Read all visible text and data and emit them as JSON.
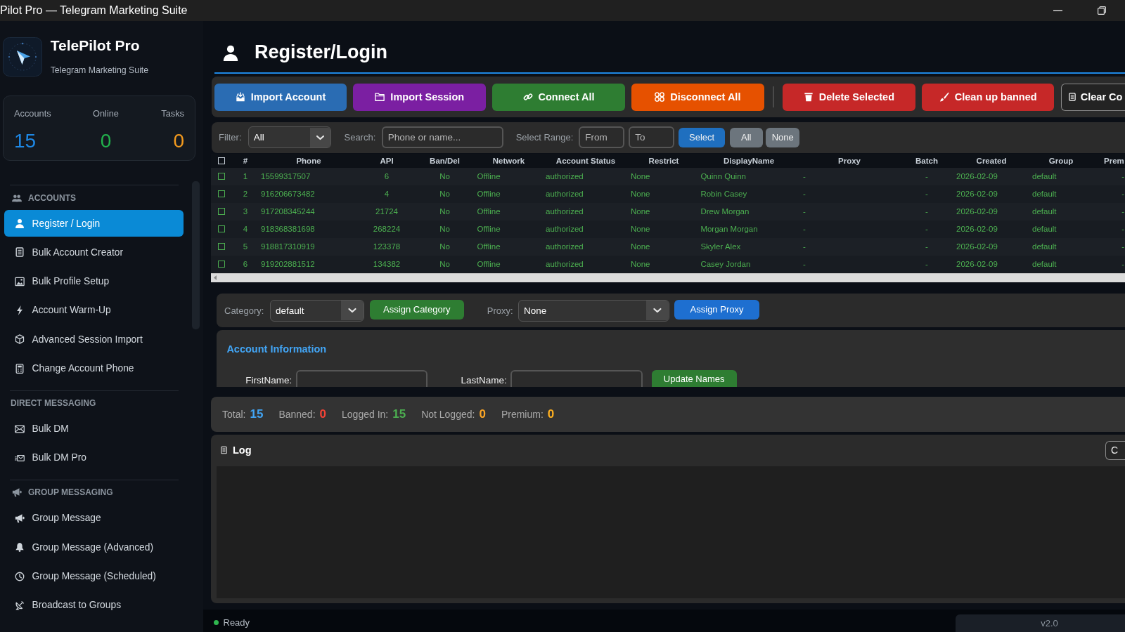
{
  "window": {
    "title": "Pilot Pro — Telegram Marketing Suite"
  },
  "sidebar": {
    "app_name": "TelePilot Pro",
    "tagline": "Telegram Marketing Suite",
    "stats": [
      {
        "label": "Accounts",
        "value": "15",
        "color": "#1e88e5"
      },
      {
        "label": "Online",
        "value": "0",
        "color": "#22b24c"
      },
      {
        "label": "Tasks",
        "value": "0",
        "color": "#f39a1e"
      }
    ],
    "sections": [
      {
        "title": "ACCOUNTS",
        "items": [
          {
            "label": "Register / Login",
            "selected": true
          },
          {
            "label": "Bulk Account Creator",
            "selected": false
          },
          {
            "label": "Bulk Profile Setup",
            "selected": false
          },
          {
            "label": "Account Warm-Up",
            "selected": false
          },
          {
            "label": "Advanced Session Import",
            "selected": false
          },
          {
            "label": "Change Account Phone",
            "selected": false
          }
        ]
      },
      {
        "title": "DIRECT MESSAGING",
        "items": [
          {
            "label": "Bulk DM",
            "selected": false
          },
          {
            "label": "Bulk DM Pro",
            "selected": false
          }
        ]
      },
      {
        "title": "GROUP MESSAGING",
        "items": [
          {
            "label": "Group Message",
            "selected": false
          },
          {
            "label": "Group Message (Advanced)",
            "selected": false
          },
          {
            "label": "Group Message (Scheduled)",
            "selected": false
          },
          {
            "label": "Broadcast to Groups",
            "selected": false
          }
        ]
      }
    ]
  },
  "page": {
    "title": "Register/Login"
  },
  "toolbar": {
    "groups": [
      {
        "buttons": [
          {
            "label": "Import Account",
            "kind": "filled",
            "color": "#2a6cb3"
          },
          {
            "label": "Import Session",
            "kind": "filled",
            "color": "#7b1fa2"
          },
          {
            "label": "Connect All",
            "kind": "filled",
            "color": "#2e7d32"
          },
          {
            "label": "Disconnect All",
            "kind": "filled",
            "color": "#e65100"
          }
        ]
      },
      {
        "buttons": [
          {
            "label": "Delete Selected",
            "kind": "filled",
            "color": "#c62828"
          },
          {
            "label": "Clean up banned",
            "kind": "filled",
            "color": "#c62828"
          },
          {
            "label": "Clear Co",
            "kind": "outline",
            "color": "#8a8a8a"
          }
        ]
      }
    ]
  },
  "filter_bar": {
    "filter": {
      "label": "Filter:",
      "value": "All"
    },
    "search": {
      "label": "Search:",
      "placeholder": "Phone or name..."
    },
    "range": {
      "label": "Select Range:",
      "from": {
        "placeholder": "From"
      },
      "to": {
        "placeholder": "To"
      }
    },
    "buttons": [
      {
        "label": "Select",
        "color": "#1f6fbf"
      },
      {
        "label": "All",
        "color": "#6c757d"
      },
      {
        "label": "None",
        "color": "#6c757d"
      }
    ]
  },
  "table": {
    "select_all": {
      "checked": false
    },
    "columns": [
      "#",
      "Phone",
      "API",
      "Ban/Del",
      "Network",
      "Account Status",
      "Restrict",
      "DisplayName",
      "Proxy",
      "Batch",
      "Created",
      "Group",
      "Prem"
    ],
    "rows": [
      {
        "checked": false,
        "cells": [
          "1",
          "15599317507",
          "6",
          "No",
          "Offline",
          "authorized",
          "None",
          "Quinn Quinn",
          "-",
          "-",
          "2026-02-09",
          "default",
          "-"
        ]
      },
      {
        "checked": false,
        "cells": [
          "2",
          "916206673482",
          "4",
          "No",
          "Offline",
          "authorized",
          "None",
          "Robin Casey",
          "-",
          "-",
          "2026-02-09",
          "default",
          "-"
        ]
      },
      {
        "checked": false,
        "cells": [
          "3",
          "917208345244",
          "21724",
          "No",
          "Offline",
          "authorized",
          "None",
          "Drew Morgan",
          "-",
          "-",
          "2026-02-09",
          "default",
          "-"
        ]
      },
      {
        "checked": false,
        "cells": [
          "4",
          "918368381698",
          "268224",
          "No",
          "Offline",
          "authorized",
          "None",
          "Morgan Morgan",
          "-",
          "-",
          "2026-02-09",
          "default",
          "-"
        ]
      },
      {
        "checked": false,
        "cells": [
          "5",
          "918817310919",
          "123378",
          "No",
          "Offline",
          "authorized",
          "None",
          "Skyler Alex",
          "-",
          "-",
          "2026-02-09",
          "default",
          "-"
        ]
      },
      {
        "checked": false,
        "cells": [
          "6",
          "919202881512",
          "134382",
          "No",
          "Offline",
          "authorized",
          "None",
          "Casey Jordan",
          "-",
          "-",
          "2026-02-09",
          "default",
          "-"
        ]
      }
    ]
  },
  "assign_bar": {
    "category": {
      "label": "Category:",
      "value": "default"
    },
    "assign_category": {
      "label": "Assign Category"
    },
    "proxy": {
      "label": "Proxy:",
      "value": "None"
    },
    "assign_proxy": {
      "label": "Assign Proxy"
    }
  },
  "account_info": {
    "title": "Account Information",
    "first_name": {
      "label": "FirstName:"
    },
    "last_name": {
      "label": "LastName:"
    },
    "update_button": {
      "label": "Update Names"
    }
  },
  "summary": [
    {
      "label": "Total:",
      "value": "15",
      "color": "#42a5f5"
    },
    {
      "label": "Banned:",
      "value": "0",
      "color": "#f44336"
    },
    {
      "label": "Logged In:",
      "value": "15",
      "color": "#4caf50"
    },
    {
      "label": "Not Logged:",
      "value": "0",
      "color": "#ffa726"
    },
    {
      "label": "Premium:",
      "value": "0",
      "color": "#ffb020"
    }
  ],
  "log": {
    "title": "Log",
    "button": {
      "label": "C"
    }
  },
  "status_bar": {
    "status": "Ready",
    "version": "v2.0"
  }
}
